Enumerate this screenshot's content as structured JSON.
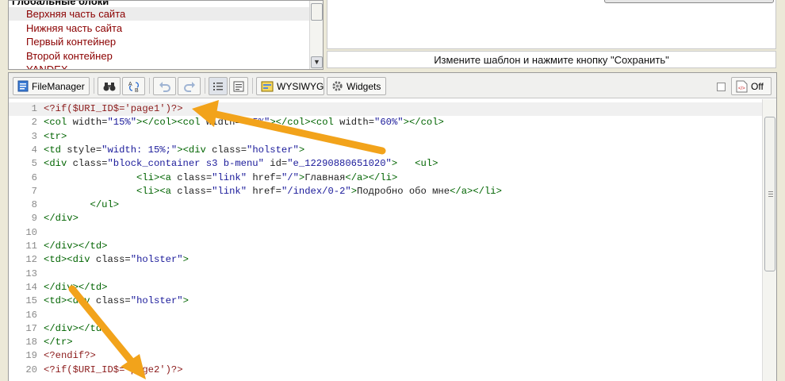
{
  "blocks_panel": {
    "header": "Глобальные блоки",
    "items": [
      "Верхняя часть сайта",
      "Нижняя часть сайта",
      "Первый контейнер",
      "Второй контейнер",
      "YANDEX"
    ],
    "selected_index": 0
  },
  "hint_text": "Измените шаблон и нажмите кнопку \"Сохранить\"",
  "toolbar": {
    "filemanager_label": "FileManager",
    "wysiwyg_label": "WYSIWYG",
    "widgets_label": "Widgets",
    "off_label": "Off"
  },
  "code_lines": [
    "<?if($URI_ID$='page1')?>",
    "<col width=\"15%\"></col><col width=\"25%\"></col><col width=\"60%\"></col>",
    "<tr>",
    "<td style=\"width: 15%;\"><div class=\"holster\">",
    "<div class=\"block_container s3 b-menu\" id=\"e_12290880651020\">   <ul>",
    "                <li><a class=\"link\" href=\"/\">Главная</a></li>",
    "                <li><a class=\"link\" href=\"/index/0-2\">Подробно обо мне</a></li>",
    "        </ul>",
    "</div>",
    "",
    "</div></td>",
    "<td><div class=\"holster\">",
    "",
    "</div></td>",
    "<td><div class=\"holster\">",
    "",
    "</div></td>",
    "</tr>",
    "<?endif?>",
    "<?if($URI_ID$='page2')?>"
  ],
  "colors": {
    "tag": "#006400",
    "string": "#1a1a9a",
    "php": "#8b1a1a",
    "arrow": "#f2a31b",
    "list_item": "#8b0000"
  }
}
